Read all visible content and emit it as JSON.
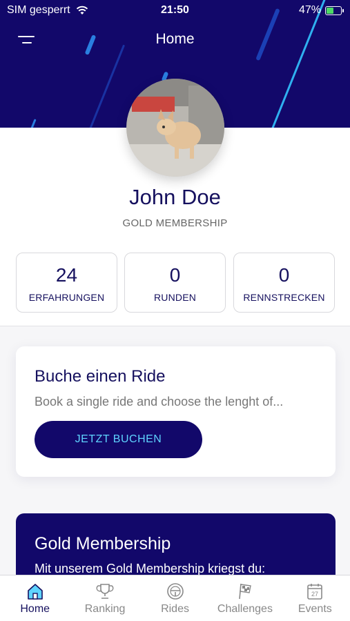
{
  "status_bar": {
    "carrier": "SIM gesperrt",
    "time": "21:50",
    "battery": "47%",
    "battery_level": 0.47
  },
  "header": {
    "title": "Home",
    "menu_icon": "hamburger-menu-icon"
  },
  "profile": {
    "name": "John Doe",
    "membership": "GOLD MEMBERSHIP"
  },
  "stats": [
    {
      "value": "24",
      "label": "ERFAHRUNGEN"
    },
    {
      "value": "0",
      "label": "RUNDEN"
    },
    {
      "value": "0",
      "label": "RENNSTRECKEN"
    }
  ],
  "ride_card": {
    "title": "Buche einen Ride",
    "description": "Book a single ride and choose the lenght of...",
    "button": "JETZT BUCHEN"
  },
  "gold_card": {
    "title": "Gold Membership",
    "description": "Mit unserem Gold Membership kriegst du:"
  },
  "tabs": [
    {
      "label": "Home",
      "icon": "home-icon",
      "active": true
    },
    {
      "label": "Ranking",
      "icon": "trophy-icon",
      "active": false
    },
    {
      "label": "Rides",
      "icon": "steering-wheel-icon",
      "active": false
    },
    {
      "label": "Challenges",
      "icon": "checkered-flag-icon",
      "active": false
    },
    {
      "label": "Events",
      "icon": "calendar-icon",
      "active": false
    }
  ],
  "calendar_day": "27",
  "colors": {
    "primary": "#12086a",
    "accent": "#5fd4ff",
    "text": "#15105e"
  }
}
